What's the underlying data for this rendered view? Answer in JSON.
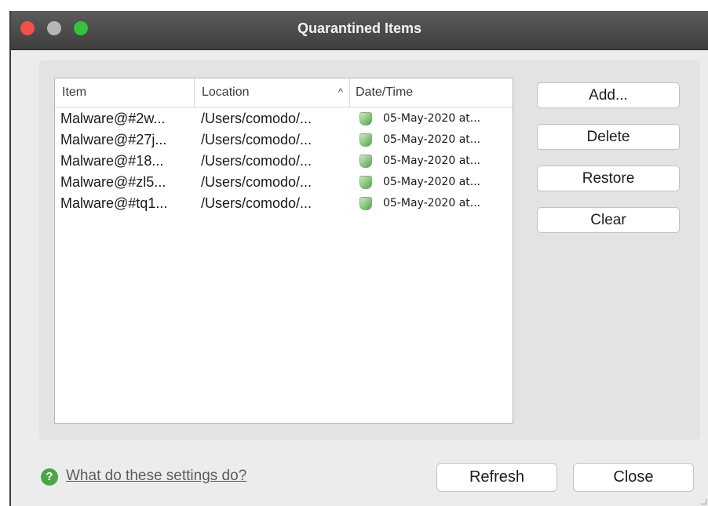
{
  "window": {
    "title": "Quarantined Items"
  },
  "table": {
    "columns": [
      "Item",
      "Location",
      "Date/Time"
    ],
    "sort_indicator": "^",
    "rows": [
      {
        "item": "Malware@#2w...",
        "location": "/Users/comodo/...",
        "date": "05-May-2020 at..."
      },
      {
        "item": "Malware@#27j...",
        "location": "/Users/comodo/...",
        "date": "05-May-2020 at..."
      },
      {
        "item": "Malware@#18...",
        "location": "/Users/comodo/...",
        "date": "05-May-2020 at..."
      },
      {
        "item": "Malware@#zl5...",
        "location": "/Users/comodo/...",
        "date": "05-May-2020 at..."
      },
      {
        "item": "Malware@#tq1...",
        "location": "/Users/comodo/...",
        "date": "05-May-2020 at..."
      }
    ]
  },
  "actions": {
    "add": "Add...",
    "delete": "Delete",
    "restore": "Restore",
    "clear": "Clear"
  },
  "footer": {
    "help_link": "What do these settings do?",
    "refresh": "Refresh",
    "close": "Close"
  },
  "icons": {
    "window_close": "close-dot-icon",
    "window_minimize": "minimize-dot-icon",
    "window_maximize": "maximize-dot-icon",
    "row_status": "shield-icon",
    "help": "help-icon"
  },
  "colors": {
    "close": "#f2504b",
    "minimize": "#b6b6b6",
    "maximize": "#35c33c",
    "help": "#4da44a"
  }
}
